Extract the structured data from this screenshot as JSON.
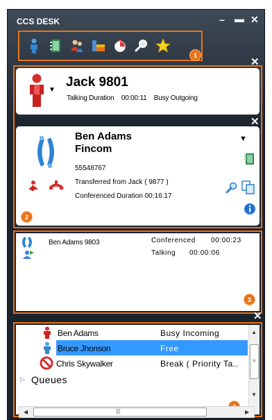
{
  "app": {
    "title": "CCS DESK",
    "minimize": "–",
    "maximize": "▬",
    "close": "✕"
  },
  "toolbar": {
    "icons": [
      "agent-icon",
      "directory-icon",
      "users-icon",
      "report-icon",
      "timer-icon",
      "search-icon",
      "favorite-icon"
    ]
  },
  "callouts": [
    "1",
    "2",
    "3",
    "4"
  ],
  "close_glyph": "✕",
  "current_call": {
    "name": "Jack 9801",
    "status_label": "Talking Duration",
    "duration": "00:00:11",
    "state": "Busy Outgoing"
  },
  "contact": {
    "name": "Ben Adams",
    "company": "Fincom",
    "phone": "55548767",
    "transfer_note": "Transferred from Jack ( 9877 )",
    "conference_label": "Conferenced Duration",
    "conference_duration": "00:16:17"
  },
  "conference": {
    "party": "Ben Adams 9803",
    "line1_label": "Conferenced",
    "line1_time": "00:00:23",
    "line2_label": "Talking",
    "line2_time": "00:00:06"
  },
  "agents": [
    {
      "name": "Ben Adams",
      "state": "Busy Incoming",
      "icon": "busy-agent-icon"
    },
    {
      "name": "Bruce Jhonson",
      "state": "Free",
      "icon": "free-agent-icon",
      "selected": true
    },
    {
      "name": "Chris Skywalker",
      "state": "Break ( Priority Ta..",
      "icon": "break-agent-icon"
    }
  ],
  "queues_label": "Queues",
  "scroll": {
    "up": "▲",
    "down": "▼",
    "left": "◀",
    "right": "▶",
    "grip": "|||"
  },
  "colors": {
    "accent": "#e8731a",
    "selection": "#3399ff",
    "frame": "#1b232c"
  }
}
